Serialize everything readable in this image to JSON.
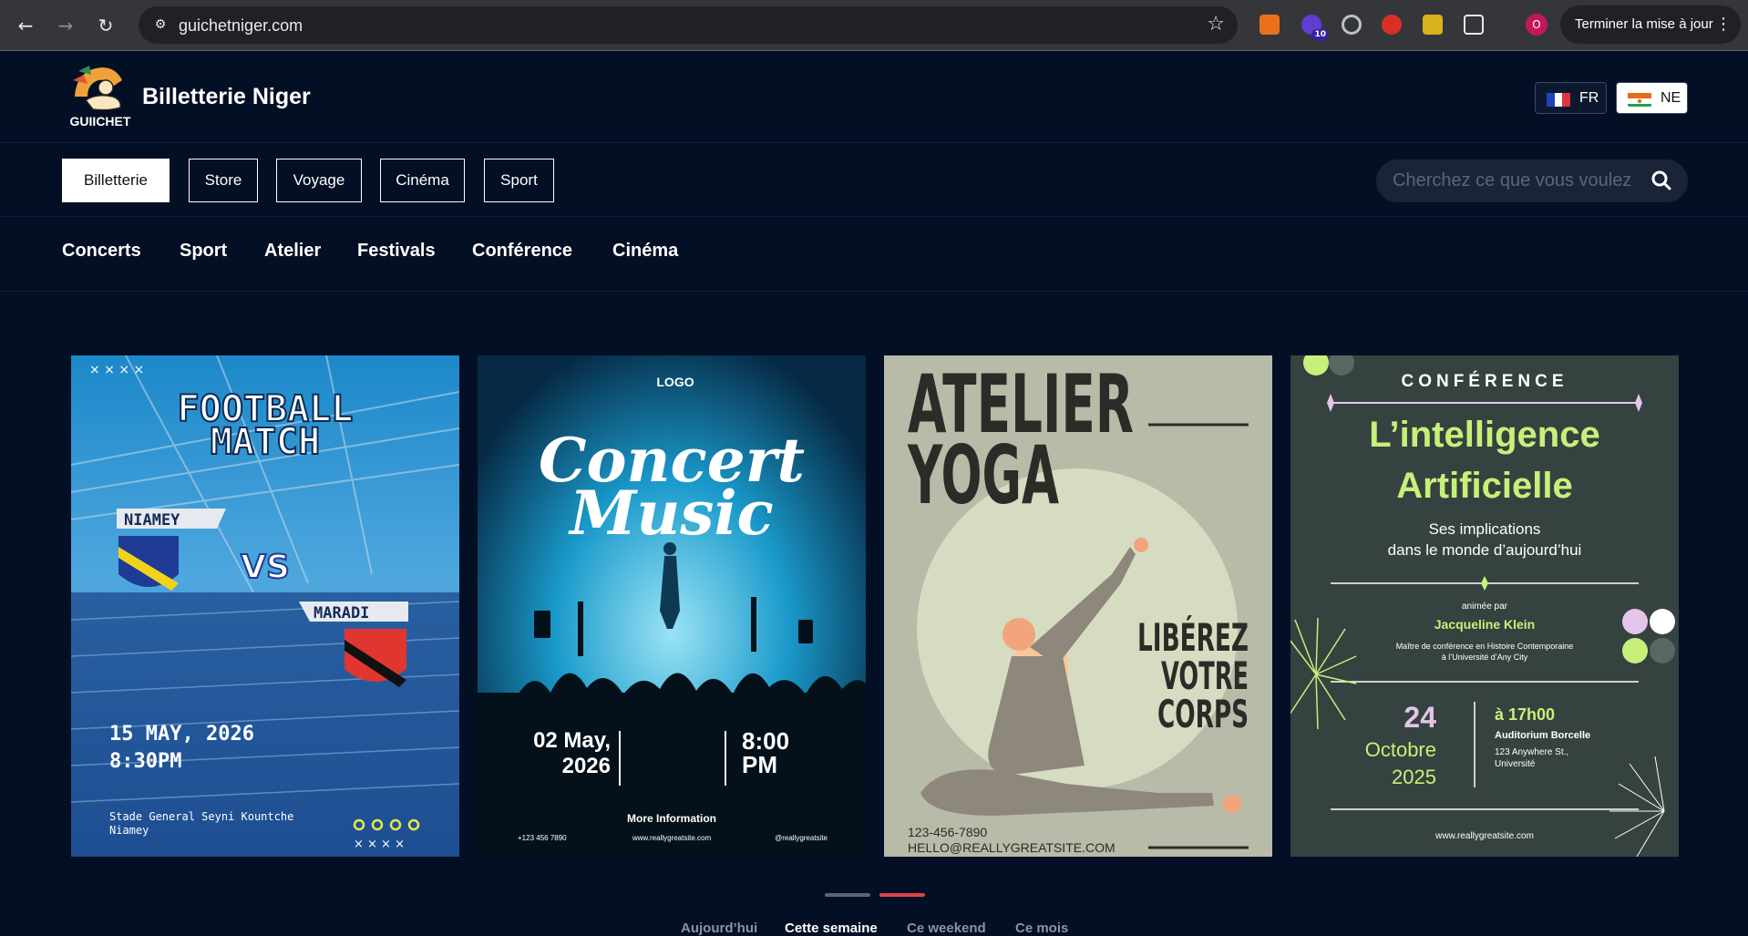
{
  "browser": {
    "url": "guichetniger.com",
    "update_label": "Terminer la mise à jour",
    "profile_initial": "O",
    "ext_badge": "10"
  },
  "header": {
    "brand": "Billetterie Niger",
    "logo_text": "GUIICHET",
    "languages": [
      {
        "code": "FR"
      },
      {
        "code": "NE"
      }
    ]
  },
  "categories": {
    "items": [
      {
        "label": "Billetterie",
        "active": true
      },
      {
        "label": "Store"
      },
      {
        "label": "Voyage"
      },
      {
        "label": "Cinéma"
      },
      {
        "label": "Sport"
      }
    ],
    "search_placeholder": "Cherchez ce que vous voulez"
  },
  "subnav": [
    "Concerts",
    "Sport",
    "Atelier",
    "Festivals",
    "Conférence",
    "Cinéma"
  ],
  "posters": {
    "football": {
      "title1": "FOOTBALL",
      "title2": "MATCH",
      "team1": "NIAMEY",
      "vs": "VS",
      "team2": "MARADI",
      "date": "15 MAY, 2026",
      "time": "8:30PM",
      "venue1": "Stade General Seyni Kountche",
      "venue2": "Niamey"
    },
    "concert": {
      "logo": "LOGO",
      "title1": "Concert",
      "title2": "Music",
      "date1": "02 May,",
      "date2": "2026",
      "time1": "8:00",
      "time2": "PM",
      "more": "More Information",
      "phone": "+123 456 7890",
      "site": "www.reallygreatsite.com",
      "social": "@reallygreatsite"
    },
    "yoga": {
      "title1": "ATELIER",
      "title2": "YOGA",
      "tag1": "LIBÉREZ",
      "tag2": "VOTRE",
      "tag3": "CORPS",
      "phone": "123-456-7890",
      "email": "HELLO@REALLYGREATSITE.COM"
    },
    "conference": {
      "kicker": "CONFÉRENCE",
      "title1": "L’intelligence",
      "title2": "Artificielle",
      "sub1": "Ses implications",
      "sub2": "dans le monde d’aujourd’hui",
      "hosted": "animée par",
      "speaker": "Jacqueline Klein",
      "role1": "Maître de conférence en Histoire Contemporaine",
      "role2": "à l’Université d’Any City",
      "day": "24",
      "month": "Octobre",
      "year": "2025",
      "time": "à 17h00",
      "place": "Auditorium Borcelle",
      "addr1": "123 Anywhere St.,",
      "addr2": "Université",
      "site": "www.reallygreatsite.com"
    }
  },
  "carousel": {
    "active_index": 1,
    "count": 2
  },
  "time_filters": [
    {
      "label": "Aujourd’hui"
    },
    {
      "label": "Cette semaine",
      "active": true
    },
    {
      "label": "Ce weekend"
    },
    {
      "label": "Ce mois"
    }
  ],
  "colors": {
    "page_bg": "#020f24",
    "accent_red": "#e0434b",
    "conference_green": "#c7f07a",
    "conference_bg": "#36423f"
  }
}
